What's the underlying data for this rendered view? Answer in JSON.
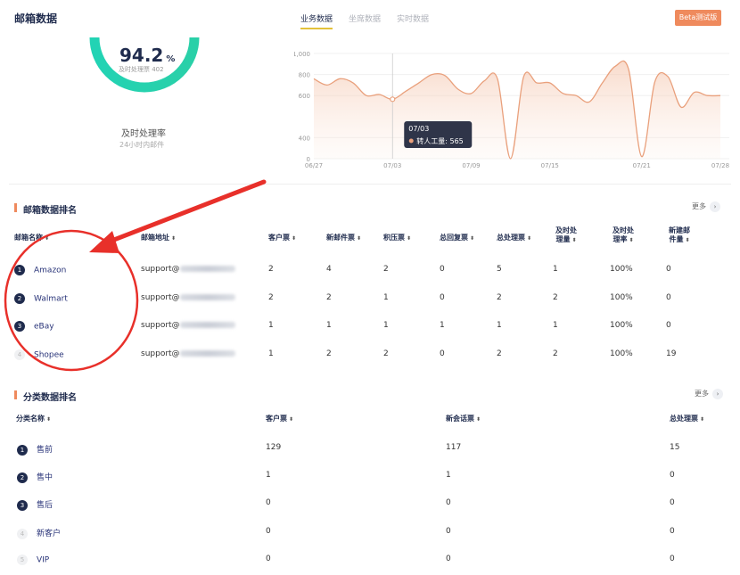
{
  "header": {
    "title": "邮箱数据",
    "tabs": [
      "业务数据",
      "坐席数据",
      "实时数据"
    ],
    "beta_label": "Beta测试版"
  },
  "gauge": {
    "value": "94.2",
    "unit": "%",
    "sub": "及时处理票 402",
    "label": "及时处理率",
    "sub2": "24小时内邮件",
    "fraction": 0.942
  },
  "line_chart": {
    "yticks": [
      "1,000",
      "800",
      "600",
      "400",
      "0"
    ],
    "xticks": [
      "06/27",
      "07/03",
      "07/09",
      "07/15",
      "07/21",
      "07/28"
    ],
    "tooltip_date": "07/03",
    "tooltip_label": "转人工量: 565",
    "color": "#e9a07c"
  },
  "chart_data": {
    "type": "area",
    "x": [
      "06/27",
      "06/28",
      "06/29",
      "06/30",
      "07/01",
      "07/02",
      "07/03",
      "07/04",
      "07/05",
      "07/06",
      "07/07",
      "07/08",
      "07/09",
      "07/10",
      "07/11",
      "07/12",
      "07/13",
      "07/14",
      "07/15",
      "07/16",
      "07/17",
      "07/18",
      "07/19",
      "07/20",
      "07/21",
      "07/22",
      "07/23",
      "07/24",
      "07/25",
      "07/26",
      "07/27",
      "07/28"
    ],
    "values": [
      760,
      700,
      760,
      720,
      600,
      610,
      565,
      640,
      720,
      800,
      790,
      660,
      620,
      740,
      760,
      0,
      780,
      720,
      720,
      620,
      600,
      540,
      720,
      880,
      850,
      20,
      730,
      780,
      490,
      630,
      600,
      600
    ],
    "yticks_raw": [
      0,
      200,
      400,
      600,
      800,
      1000
    ]
  },
  "mailbox_section": {
    "title": "邮箱数据排名",
    "more": "更多",
    "headers": [
      "邮箱名称",
      "邮箱地址",
      "客户票",
      "新邮件票",
      "积压票",
      "总回复票",
      "总处理票",
      "及时处理量",
      "及时处理率",
      "新建邮件量"
    ],
    "rows": [
      {
        "rank": "1",
        "name": "Amazon",
        "addr": "support@",
        "c1": "2",
        "c2": "4",
        "c3": "2",
        "c4": "0",
        "c5": "5",
        "c6": "1",
        "c7": "100%",
        "c8": "0"
      },
      {
        "rank": "2",
        "name": "Walmart",
        "addr": "support@",
        "c1": "2",
        "c2": "2",
        "c3": "1",
        "c4": "0",
        "c5": "2",
        "c6": "2",
        "c7": "100%",
        "c8": "0"
      },
      {
        "rank": "3",
        "name": "eBay",
        "addr": "support@",
        "c1": "1",
        "c2": "1",
        "c3": "1",
        "c4": "1",
        "c5": "1",
        "c6": "1",
        "c7": "100%",
        "c8": "0"
      },
      {
        "rank": "4",
        "name": "Shopee",
        "addr": "support@",
        "c1": "1",
        "c2": "2",
        "c3": "2",
        "c4": "0",
        "c5": "2",
        "c6": "2",
        "c7": "100%",
        "c8": "19"
      }
    ]
  },
  "category_section": {
    "title": "分类数据排名",
    "more": "更多",
    "headers": [
      "分类名称",
      "客户票",
      "新会话票",
      "总处理票"
    ],
    "rows": [
      {
        "rank": "1",
        "name": "售前",
        "c1": "129",
        "c2": "117",
        "c3": "15"
      },
      {
        "rank": "2",
        "name": "售中",
        "c1": "1",
        "c2": "1",
        "c3": "0"
      },
      {
        "rank": "3",
        "name": "售后",
        "c1": "0",
        "c2": "0",
        "c3": "0"
      },
      {
        "rank": "4",
        "name": "新客户",
        "c1": "0",
        "c2": "0",
        "c3": "0"
      },
      {
        "rank": "5",
        "name": "VIP",
        "c1": "0",
        "c2": "0",
        "c3": "0"
      }
    ]
  },
  "annotation_color": "#e8302a"
}
